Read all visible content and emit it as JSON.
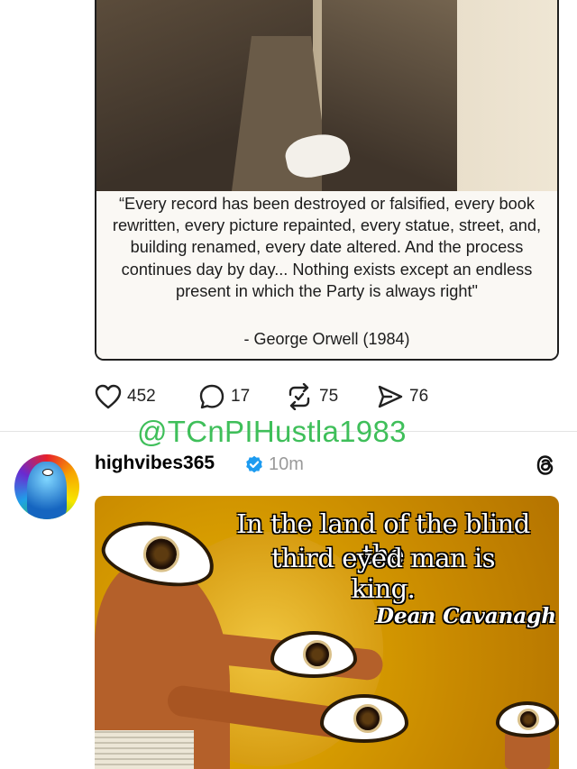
{
  "post1": {
    "quote": "“Every record has been destroyed or falsified, every book rewritten, every picture repainted, every statue, street, and, building renamed, every date altered. And the process continues day by day... Nothing exists except an endless present in which the Party is always right\"",
    "attribution": "- George Orwell (1984)",
    "actions": {
      "likes": "452",
      "replies": "17",
      "reposts": "75",
      "shares": "76"
    }
  },
  "watermark": "@TCnPIHustla1983",
  "post2": {
    "username": "highvibes365",
    "verified": true,
    "timestamp": "10m",
    "image_text_line1": "In the land of the blind the",
    "image_text_line2": "third eyed man is king.",
    "image_signature": "Dean Cavanagh"
  },
  "icons": {
    "like": "heart-icon",
    "reply": "comment-icon",
    "repost": "repost-icon",
    "share": "send-icon",
    "verified": "verified-badge-icon",
    "threads": "threads-logo-icon"
  },
  "colors": {
    "watermark": "#3fbf5a",
    "verified": "#1d9bf0",
    "timestamp": "#9a9a9a"
  }
}
